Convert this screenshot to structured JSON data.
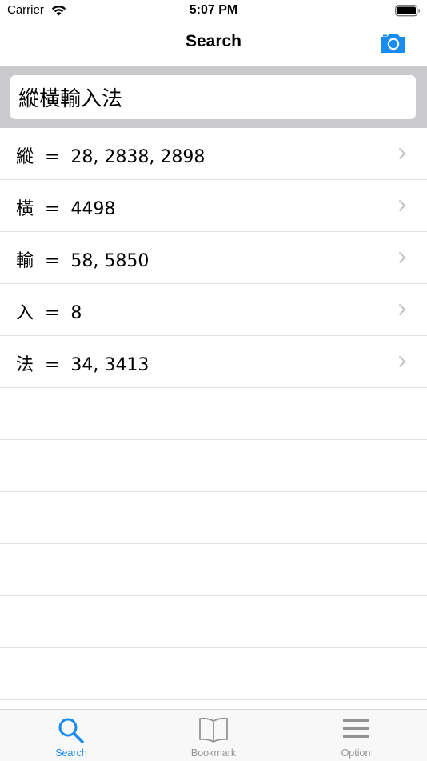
{
  "status_bar": {
    "carrier": "Carrier",
    "time": "5:07 PM"
  },
  "nav": {
    "title": "Search",
    "camera_icon": "camera-icon"
  },
  "search": {
    "value": "縱橫輸入法"
  },
  "results": [
    {
      "text": "縱  =  28, 2838, 2898"
    },
    {
      "text": "橫  =  4498"
    },
    {
      "text": "輸  =  58, 5850"
    },
    {
      "text": "入  =  8"
    },
    {
      "text": "法  =  34, 3413"
    }
  ],
  "tabs": [
    {
      "label": "Search",
      "icon": "search-icon",
      "active": true
    },
    {
      "label": "Bookmark",
      "icon": "book-icon",
      "active": false
    },
    {
      "label": "Option",
      "icon": "menu-icon",
      "active": false
    }
  ],
  "colors": {
    "accent": "#1a8cf0",
    "search_bg": "#c9c9ce",
    "tab_inactive": "#929292"
  }
}
